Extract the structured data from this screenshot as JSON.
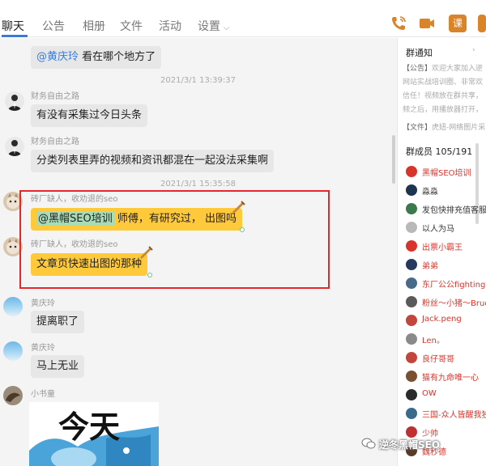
{
  "tabs": [
    {
      "label": "聊天"
    },
    {
      "label": "公告"
    },
    {
      "label": "相册"
    },
    {
      "label": "文件"
    },
    {
      "label": "活动"
    },
    {
      "label": "设置"
    }
  ],
  "top_icons": [
    "phone-icon",
    "video-icon",
    "lesson-icon"
  ],
  "lesson_icon_text": "课",
  "messages": [
    {
      "mention": "@黄庆玲",
      "text": " 看在哪个地方了"
    },
    {
      "time": "2021/3/1 13:39:37"
    },
    {
      "sender": "财务自由之路",
      "text": "有没有采集过今日头条"
    },
    {
      "sender": "财务自由之路",
      "text": "分类列表里弄的视频和资讯都混在一起没法采集啊"
    },
    {
      "time": "2021/3/1 15:35:58"
    },
    {
      "sender": "砖厂缺人，收劝退的seo",
      "mention": "@黑帽SEO培训",
      "text": " 师傅，有研究过， 出图吗"
    },
    {
      "sender": "砖厂缺人，收劝退的seo",
      "text": "文章页快速出图的那种"
    },
    {
      "sender": "黄庆玲",
      "text": "提离职了"
    },
    {
      "sender": "黄庆玲",
      "text": "马上无业"
    },
    {
      "sender": "小书童",
      "sticker_text": "今天"
    }
  ],
  "panel": {
    "notice_title": "群通知",
    "notice_lines": [
      {
        "label": "【公告】",
        "text": "欢迎大家加入逆"
      },
      {
        "text": "网站实战培训圈、非常欢"
      },
      {
        "text": "信任！视频放在群共享，"
      },
      {
        "text": "频之后，用播放器打开，"
      },
      {
        "label": "【文件】",
        "text": "虎妞-网络图片采"
      }
    ],
    "members_title": "群成员 105/191",
    "members": [
      {
        "name": "黑帽SEO培训",
        "red": true,
        "color": "#d9342b"
      },
      {
        "name": "淼淼",
        "red": false,
        "color": "#1e3550"
      },
      {
        "name": "发包快排充值客服",
        "red": false,
        "color": "#3b7a4c"
      },
      {
        "name": "以人为马",
        "red": false,
        "color": "#b9b9b9"
      },
      {
        "name": "出票小霸王",
        "red": true,
        "color": "#d9342b"
      },
      {
        "name": "弟弟",
        "red": true,
        "color": "#243a5e"
      },
      {
        "name": "东厂公公fighting",
        "red": true,
        "color": "#4a6a8a"
      },
      {
        "name": "粉丝～小猪～Bruce",
        "red": true,
        "color": "#5a5a5a"
      },
      {
        "name": "Jack.peng",
        "red": true,
        "color": "#c2463b"
      },
      {
        "name": "Len。",
        "red": true,
        "color": "#8a8a8a"
      },
      {
        "name": "良仔哥哥",
        "red": true,
        "color": "#c2463b"
      },
      {
        "name": "猫有九命唯一心",
        "red": true,
        "color": "#7a5030"
      },
      {
        "name": "OW",
        "red": true,
        "color": "#2a2a2a"
      },
      {
        "name": "三国-众人皆醒我独",
        "red": true,
        "color": "#3a6a8a"
      },
      {
        "name": "少帅",
        "red": true,
        "color": "#c03030"
      },
      {
        "name": "魏秒德",
        "red": true,
        "color": "#5a3a2a"
      }
    ]
  },
  "watermark": "逆冬黑帽SEO"
}
